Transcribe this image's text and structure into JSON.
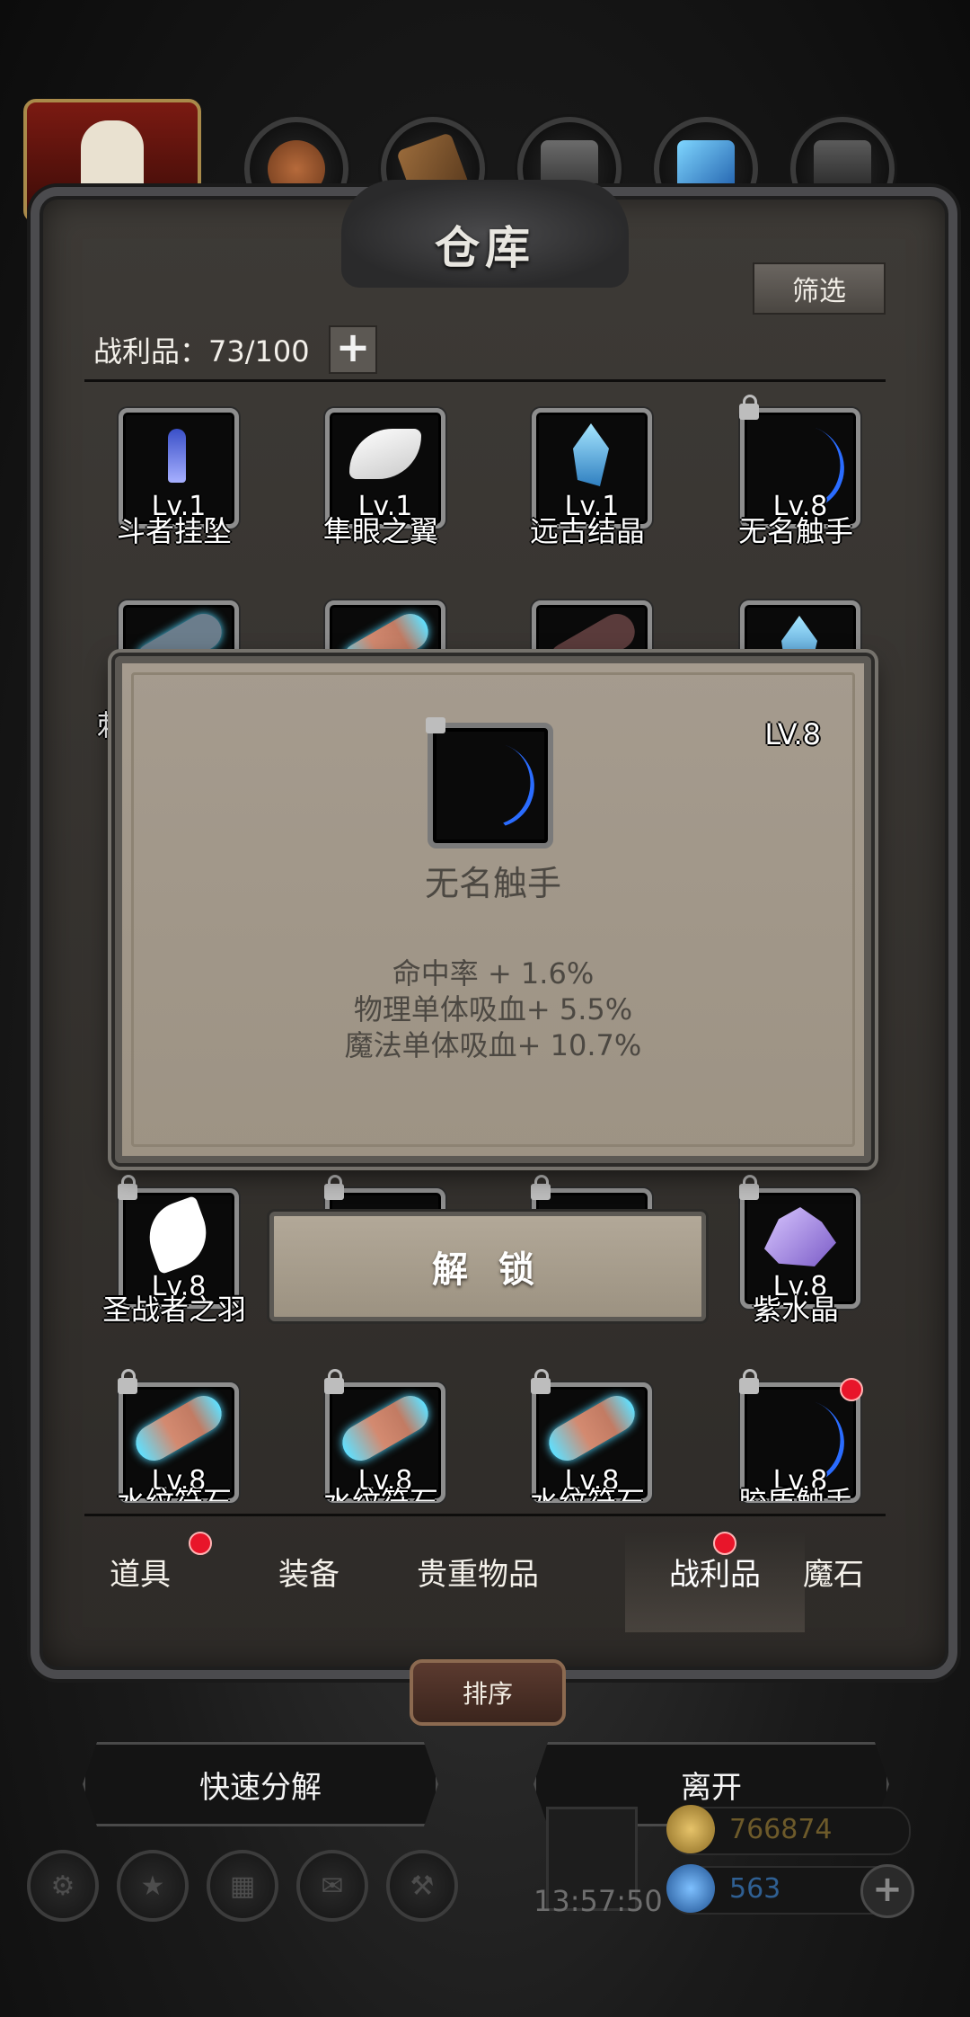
{
  "header": {
    "title": "仓库"
  },
  "toolbar": {
    "filter_label": "筛选",
    "loot_count_label": "战利品：73/100",
    "add_label": "+"
  },
  "items": [
    {
      "level": "Lv.1",
      "name": "斗者挂坠"
    },
    {
      "level": "Lv.1",
      "name": "隼眼之翼"
    },
    {
      "level": "Lv.1",
      "name": "远古结晶"
    },
    {
      "level": "Lv.8",
      "name": "无名触手"
    },
    {
      "level": "Lv.8",
      "name": "圣战者之羽"
    },
    {
      "level": "Lv.8",
      "name": "紫水晶"
    },
    {
      "level": "Lv.8",
      "name": "水纹符石"
    },
    {
      "level": "Lv.8",
      "name": "水纹符石"
    },
    {
      "level": "Lv.8",
      "name": "水纹符石"
    },
    {
      "level": "Lv.8",
      "name": "胶质触手"
    }
  ],
  "partial_row_left_char": "刺",
  "dialog": {
    "level": "LV.8",
    "name": "无名触手",
    "stats": [
      "命中率 + 1.6%",
      "物理单体吸血+ 5.5%",
      "魔法单体吸血+ 10.7%"
    ],
    "unlock_label": "解 锁"
  },
  "tabs": [
    {
      "label": "道具",
      "badge": true
    },
    {
      "label": "装备",
      "badge": false
    },
    {
      "label": "贵重物品",
      "badge": false
    },
    {
      "label": "战利品",
      "badge": true,
      "active": true
    },
    {
      "label": "魔石",
      "badge": false
    }
  ],
  "actions": {
    "sort_label": "排序",
    "quick_decompose_label": "快速分解",
    "leave_label": "离开"
  },
  "status": {
    "timer": "13:57:50",
    "gold": "766874",
    "gems": "563"
  },
  "colors": {
    "badge": "#e8152a",
    "panel": "#3d3a36",
    "dialog": "#a59b8e",
    "gold": "#c9a24a",
    "gem": "#3a7fd0"
  }
}
